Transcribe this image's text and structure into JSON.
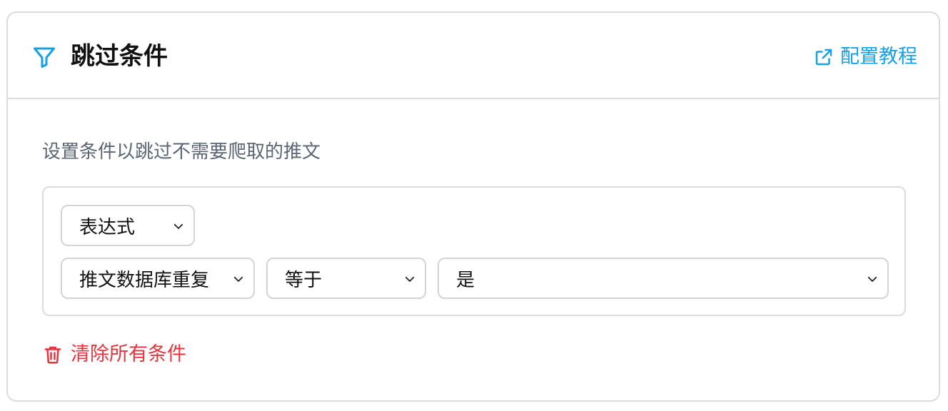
{
  "header": {
    "title": "跳过条件",
    "tutorial_link": "配置教程"
  },
  "body": {
    "description": "设置条件以跳过不需要爬取的推文",
    "condition_type": {
      "selected": "表达式"
    },
    "condition": {
      "field": "推文数据库重复",
      "operator": "等于",
      "value": "是"
    },
    "clear_label": "清除所有条件"
  },
  "colors": {
    "accent": "#16a0e6",
    "danger": "#e5343d",
    "border": "#dcdcdf",
    "muted_text": "#5b6573"
  },
  "icons": [
    "filter-icon",
    "external-link-icon",
    "chevron-down-icon",
    "trash-icon"
  ]
}
